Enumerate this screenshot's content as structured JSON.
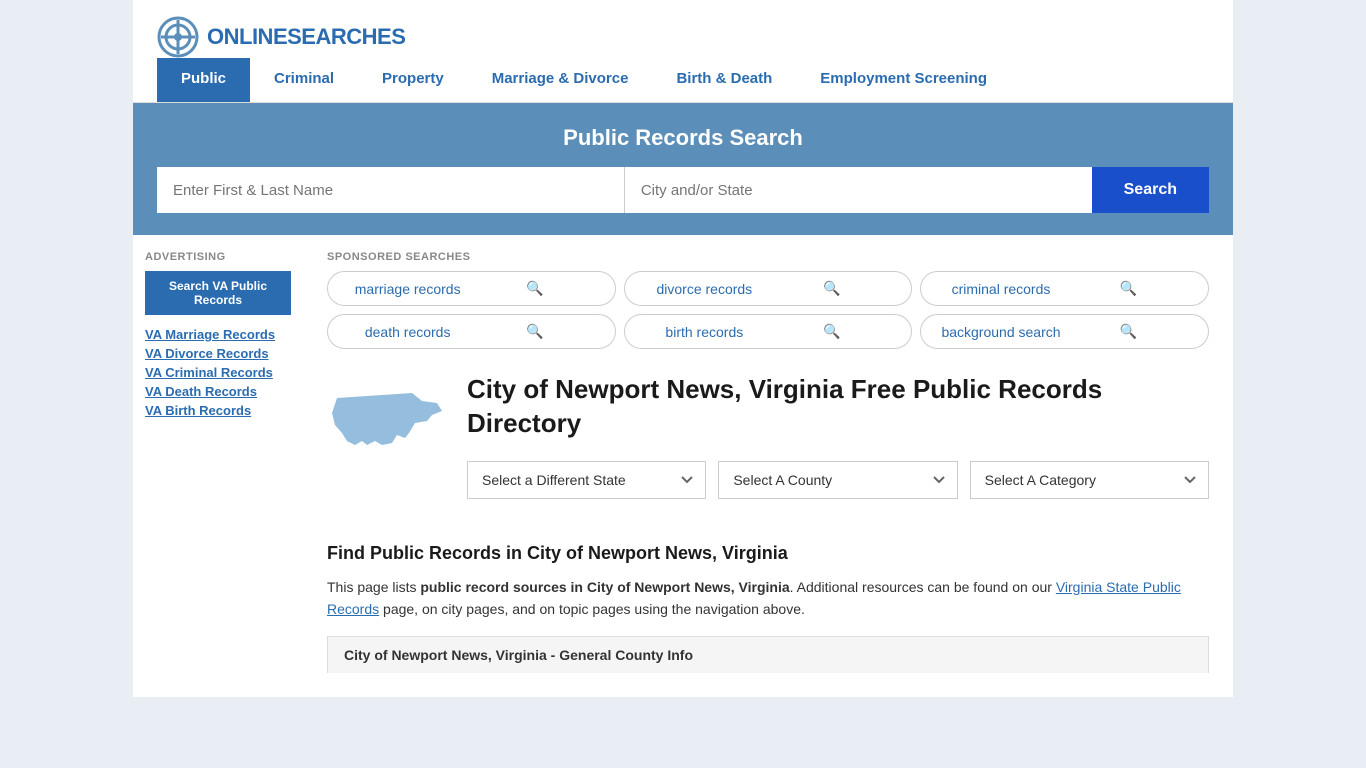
{
  "site": {
    "logo_text_plain": "ONLINE",
    "logo_text_colored": "SEARCHES",
    "title": "OnlineSearches"
  },
  "nav": {
    "items": [
      {
        "id": "public",
        "label": "Public",
        "active": true
      },
      {
        "id": "criminal",
        "label": "Criminal",
        "active": false
      },
      {
        "id": "property",
        "label": "Property",
        "active": false
      },
      {
        "id": "marriage-divorce",
        "label": "Marriage & Divorce",
        "active": false
      },
      {
        "id": "birth-death",
        "label": "Birth & Death",
        "active": false
      },
      {
        "id": "employment",
        "label": "Employment Screening",
        "active": false
      }
    ]
  },
  "search_banner": {
    "title": "Public Records Search",
    "name_placeholder": "Enter First & Last Name",
    "location_placeholder": "City and/or State",
    "search_button_label": "Search"
  },
  "sponsored": {
    "label": "SPONSORED SEARCHES",
    "items": [
      {
        "id": "marriage-records",
        "label": "marriage records"
      },
      {
        "id": "divorce-records",
        "label": "divorce records"
      },
      {
        "id": "criminal-records",
        "label": "criminal records"
      },
      {
        "id": "death-records",
        "label": "death records"
      },
      {
        "id": "birth-records",
        "label": "birth records"
      },
      {
        "id": "background-search",
        "label": "background search"
      }
    ]
  },
  "page": {
    "title": "City of Newport News, Virginia Free Public Records Directory",
    "dropdowns": {
      "state": {
        "label": "Select a Different State",
        "options": []
      },
      "county": {
        "label": "Select A County",
        "options": []
      },
      "category": {
        "label": "Select A Category",
        "options": []
      }
    },
    "find_title": "Find Public Records in City of Newport News, Virginia",
    "find_description_before": "This page lists ",
    "find_description_bold": "public record sources in City of Newport News, Virginia",
    "find_description_after": ". Additional resources can be found on our ",
    "find_link_text": "Virginia State Public Records",
    "find_description_end": " page, on city pages, and on topic pages using the navigation above.",
    "county_info_bar": "City of Newport News, Virginia - General County Info"
  },
  "sidebar": {
    "advertising_label": "Advertising",
    "search_btn_label": "Search VA Public Records",
    "links": [
      {
        "id": "va-marriage",
        "label": "VA Marriage Records"
      },
      {
        "id": "va-divorce",
        "label": "VA Divorce Records"
      },
      {
        "id": "va-criminal",
        "label": "VA Criminal Records"
      },
      {
        "id": "va-death",
        "label": "VA Death Records"
      },
      {
        "id": "va-birth",
        "label": "VA Birth Records"
      }
    ]
  },
  "colors": {
    "primary_blue": "#2b6cb0",
    "nav_blue": "#2b6cb0",
    "banner_blue": "#5b8fb9",
    "search_btn_blue": "#1a4fcc",
    "sidebar_btn_blue": "#2b6cb0"
  }
}
